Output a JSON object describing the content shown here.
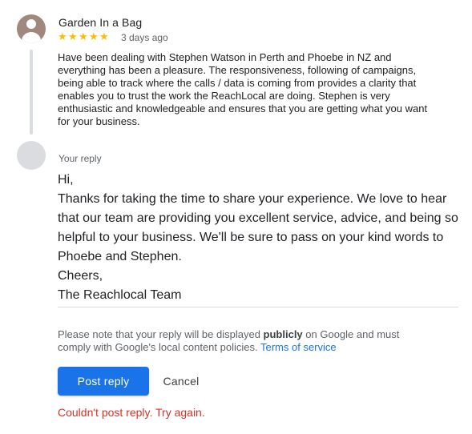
{
  "review": {
    "author": "Garden In a Bag",
    "rating": 5,
    "stars": [
      "★",
      "★",
      "★",
      "★",
      "★"
    ],
    "time": "3 days ago",
    "text_lines": [
      "Have been dealing with Stephen Watson in Perth and Phoebe in NZ and",
      "everything has been a pleasure. The responsiveness, following of campaigns,",
      "being able to track where the calls / data is coming from provides a clarity that",
      "enables you to trust the work the ReachLocal are doing. Stephen is very",
      "enthusiastic and knowledgeable and ensures that you are getting what you want",
      "for your business."
    ]
  },
  "reply": {
    "label": "Your reply",
    "lines": [
      "Hi,",
      "Thanks for taking the time to share your experience. We love to hear",
      "that our team are providing you excellent service, advice, and being so",
      "helpful to your business. We'll be sure to pass on your kind words to",
      "Phoebe and Stephen.",
      "Cheers,",
      "The Reachlocal Team"
    ]
  },
  "notice": {
    "prefix": "Please note that your reply will be displayed ",
    "bold": "publicly",
    "middle_line1": " on Google and must",
    "line2": "comply with Google's local content policies. ",
    "link": "Terms of service"
  },
  "actions": {
    "post_label": "Post reply",
    "cancel_label": "Cancel"
  },
  "error": "Couldn't post reply. Try again.",
  "colors": {
    "accent": "#1a73e8",
    "star": "#fbbc04",
    "error": "#d93025",
    "avatar": "#a1887f"
  }
}
